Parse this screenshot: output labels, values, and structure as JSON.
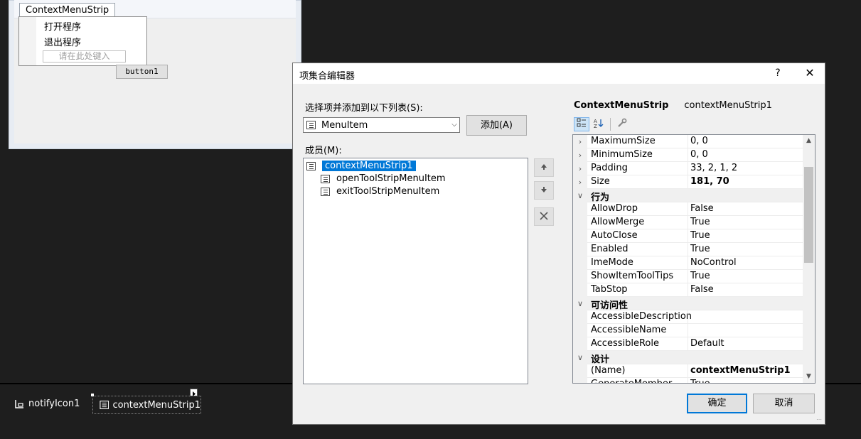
{
  "designer": {
    "context_menu_strip_tab": "ContextMenuStrip",
    "menu_items": [
      "打开程序",
      "退出程序"
    ],
    "type_here_placeholder": "请在此处键入",
    "button1_label": "button1"
  },
  "tray": {
    "notify_icon_label": "notifyIcon1",
    "context_menu_label": "contextMenuStrip1"
  },
  "dialog": {
    "title": "项集合编辑器",
    "help_glyph": "?",
    "close_glyph": "✕",
    "select_label": "选择项并添加到以下列表(S):",
    "type_combo_value": "MenuItem",
    "add_button": "添加(A)",
    "members_label": "成员(M):",
    "members": [
      "contextMenuStrip1",
      "openToolStripMenuItem",
      "exitToolStripMenuItem"
    ],
    "ok_button": "确定",
    "cancel_button": "取消"
  },
  "property_grid": {
    "object_type": "ContextMenuStrip",
    "object_name": "contextMenuStrip1",
    "rows": [
      {
        "kind": "prop",
        "expandable": true,
        "name": "MaximumSize",
        "value": "0, 0"
      },
      {
        "kind": "prop",
        "expandable": true,
        "name": "MinimumSize",
        "value": "0, 0"
      },
      {
        "kind": "prop",
        "expandable": true,
        "name": "Padding",
        "value": "33, 2, 1, 2"
      },
      {
        "kind": "prop",
        "expandable": true,
        "name": "Size",
        "value": "181, 70",
        "bold": true
      },
      {
        "kind": "category",
        "name": "行为"
      },
      {
        "kind": "prop",
        "name": "AllowDrop",
        "value": "False"
      },
      {
        "kind": "prop",
        "name": "AllowMerge",
        "value": "True"
      },
      {
        "kind": "prop",
        "name": "AutoClose",
        "value": "True"
      },
      {
        "kind": "prop",
        "name": "Enabled",
        "value": "True"
      },
      {
        "kind": "prop",
        "name": "ImeMode",
        "value": "NoControl"
      },
      {
        "kind": "prop",
        "name": "ShowItemToolTips",
        "value": "True"
      },
      {
        "kind": "prop",
        "name": "TabStop",
        "value": "False"
      },
      {
        "kind": "category",
        "name": "可访问性"
      },
      {
        "kind": "prop",
        "name": "AccessibleDescription",
        "value": ""
      },
      {
        "kind": "prop",
        "name": "AccessibleName",
        "value": ""
      },
      {
        "kind": "prop",
        "name": "AccessibleRole",
        "value": "Default"
      },
      {
        "kind": "category",
        "name": "设计"
      },
      {
        "kind": "prop",
        "name": "(Name)",
        "value": "contextMenuStrip1",
        "bold": true
      },
      {
        "kind": "prop",
        "name": "GenerateMember",
        "value": "True"
      }
    ]
  }
}
